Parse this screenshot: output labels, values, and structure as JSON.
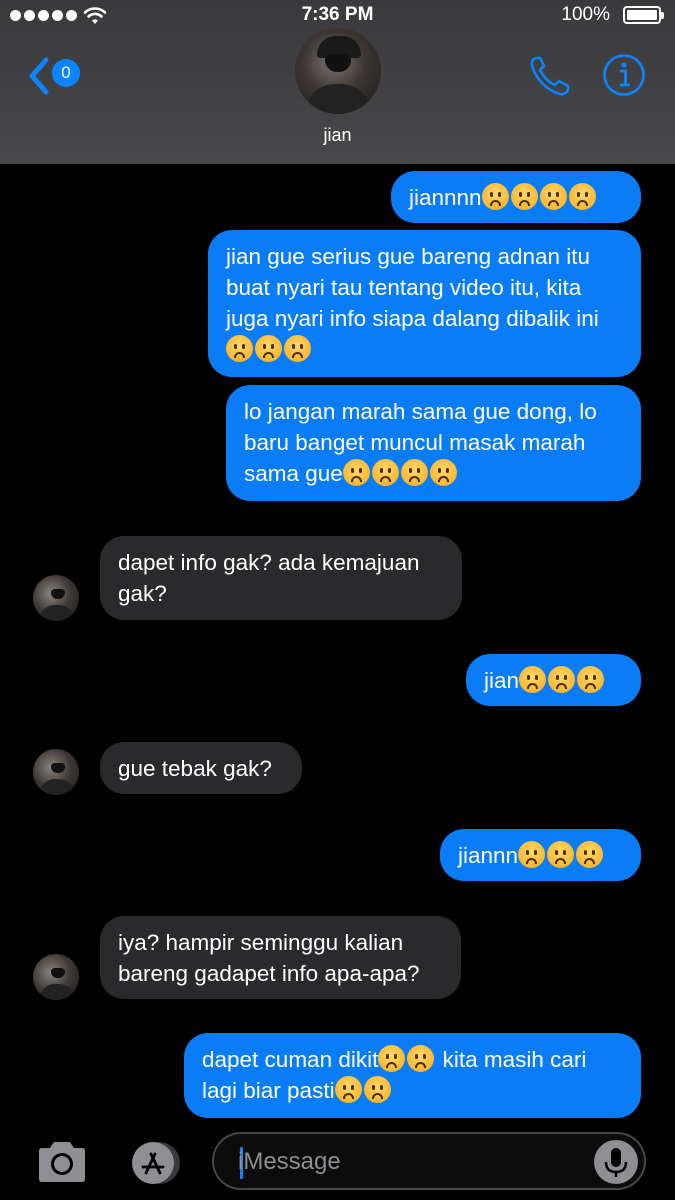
{
  "status_bar": {
    "time": "7:36 PM",
    "battery_percent": "100%",
    "battery_level": 1.0,
    "signal_bars": 5,
    "icons": [
      "signal-dots-icon",
      "wifi-icon",
      "battery-icon"
    ]
  },
  "header": {
    "back_badge": "0",
    "contact_name": "jian",
    "icons": [
      "chevron-left-icon",
      "phone-icon",
      "info-icon"
    ]
  },
  "colors": {
    "accent": "#0a84ff",
    "sent_bubble": "#0a7cf5",
    "received_bubble": "#2a2a2d",
    "header_bg": "#3a3a3c"
  },
  "messages": [
    {
      "direction": "sent",
      "text": "jiannnn",
      "emoji_after": 4
    },
    {
      "direction": "sent",
      "text": "jian gue serius gue bareng adnan itu buat nyari tau tentang video itu, kita juga nyari info siapa dalang dibalik ini",
      "emoji_after": 3
    },
    {
      "direction": "sent",
      "text": "lo jangan marah sama gue dong, lo baru banget muncul masak marah sama gue",
      "emoji_after": 4
    },
    {
      "direction": "received",
      "text": "dapet info gak? ada kemajuan gak?"
    },
    {
      "direction": "sent",
      "text": "jian",
      "emoji_after": 3
    },
    {
      "direction": "received",
      "text": "gue tebak gak?"
    },
    {
      "direction": "sent",
      "text": "jiannn",
      "emoji_after": 3
    },
    {
      "direction": "received",
      "text": "iya? hampir seminggu kalian bareng gadapet info apa-apa?"
    },
    {
      "direction": "sent",
      "text_parts": [
        "dapet cuman dikit",
        "kita masih cari lagi biar pasti"
      ],
      "emoji_groups": [
        2,
        2
      ]
    }
  ],
  "emoji_name": "frowning-face-emoji",
  "input_bar": {
    "placeholder": "iMessage",
    "icons": [
      "camera-icon",
      "app-store-icon",
      "microphone-icon"
    ]
  }
}
